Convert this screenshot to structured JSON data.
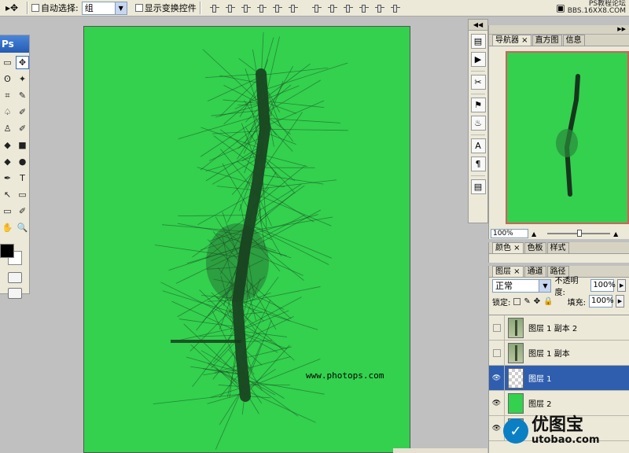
{
  "options_bar": {
    "tool_glyph": "▸✥",
    "auto_select_label": "自动选择:",
    "auto_select_value": "组",
    "show_transform_label": "显示变换控件",
    "site_watermark": "PS教程论坛\nBBS.16XX8.COM"
  },
  "toolbox": {
    "logo": "Ps",
    "tools": [
      "▭",
      "✥",
      "ʘ",
      "✦",
      "⌗",
      "✎",
      "♤",
      "✐",
      "♙",
      "✐",
      "◆",
      "■",
      "◆",
      "●",
      "✒",
      "T",
      "↖",
      "▭",
      "▭",
      "✐",
      "✋",
      "🔍"
    ]
  },
  "canvas": {
    "url_text": "www.photops.com"
  },
  "strip_icons": [
    "▤",
    "▶",
    "✂",
    "⚑",
    "♨",
    "A",
    "¶",
    "▤"
  ],
  "navigator": {
    "tabs": [
      "导航器 ×",
      "直方图",
      "信息"
    ],
    "zoom": "100%"
  },
  "color_panel": {
    "tabs": [
      "颜色 ×",
      "色板",
      "样式"
    ]
  },
  "layers_panel": {
    "tabs": [
      "图层 ×",
      "通道",
      "路径"
    ],
    "blend_mode": "正常",
    "opacity_label": "不透明度:",
    "opacity": "100%",
    "lock_label": "锁定:",
    "fill_label": "填充:",
    "fill": "100%",
    "layers": [
      {
        "name": "图层 1 副本 2",
        "visible": false,
        "thumb": "bug",
        "selected": false
      },
      {
        "name": "图层 1 副本",
        "visible": false,
        "thumb": "bug",
        "selected": false
      },
      {
        "name": "图层 1",
        "visible": true,
        "thumb": "trans",
        "selected": true
      },
      {
        "name": "图层 2",
        "visible": true,
        "thumb": "green",
        "selected": false
      },
      {
        "name": "",
        "visible": true,
        "thumb": "bug",
        "selected": false
      }
    ]
  },
  "brand": {
    "cn": "优图宝",
    "en": "utobao.com"
  },
  "colors": {
    "canvas_green": "#33d14e",
    "selection_blue": "#2f5eae",
    "panel_bg": "#ece9d8"
  }
}
